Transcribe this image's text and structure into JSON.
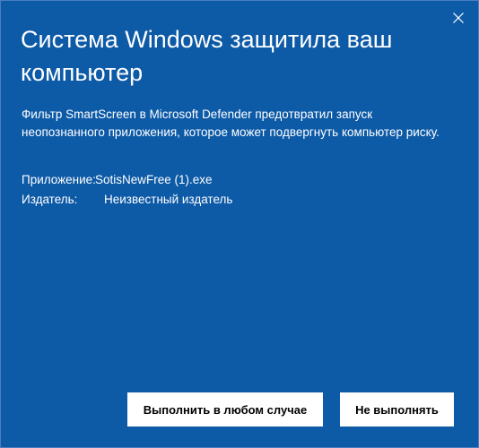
{
  "dialog": {
    "title": "Система Windows защитила ваш компьютер",
    "description": "Фильтр SmartScreen в Microsoft Defender предотвратил запуск неопознанного приложения, которое может подвергнуть компьютер риску.",
    "details": {
      "app_label": "Приложение:",
      "app_value": "SotisNewFree (1).exe",
      "publisher_label": "Издатель:",
      "publisher_value": "Неизвестный издатель"
    },
    "buttons": {
      "run_anyway": "Выполнить в любом случае",
      "dont_run": "Не выполнять"
    },
    "close_icon": "close-icon"
  },
  "colors": {
    "background": "#0d5aa7",
    "text": "#ffffff",
    "button_bg": "#ffffff",
    "button_text": "#000000"
  }
}
